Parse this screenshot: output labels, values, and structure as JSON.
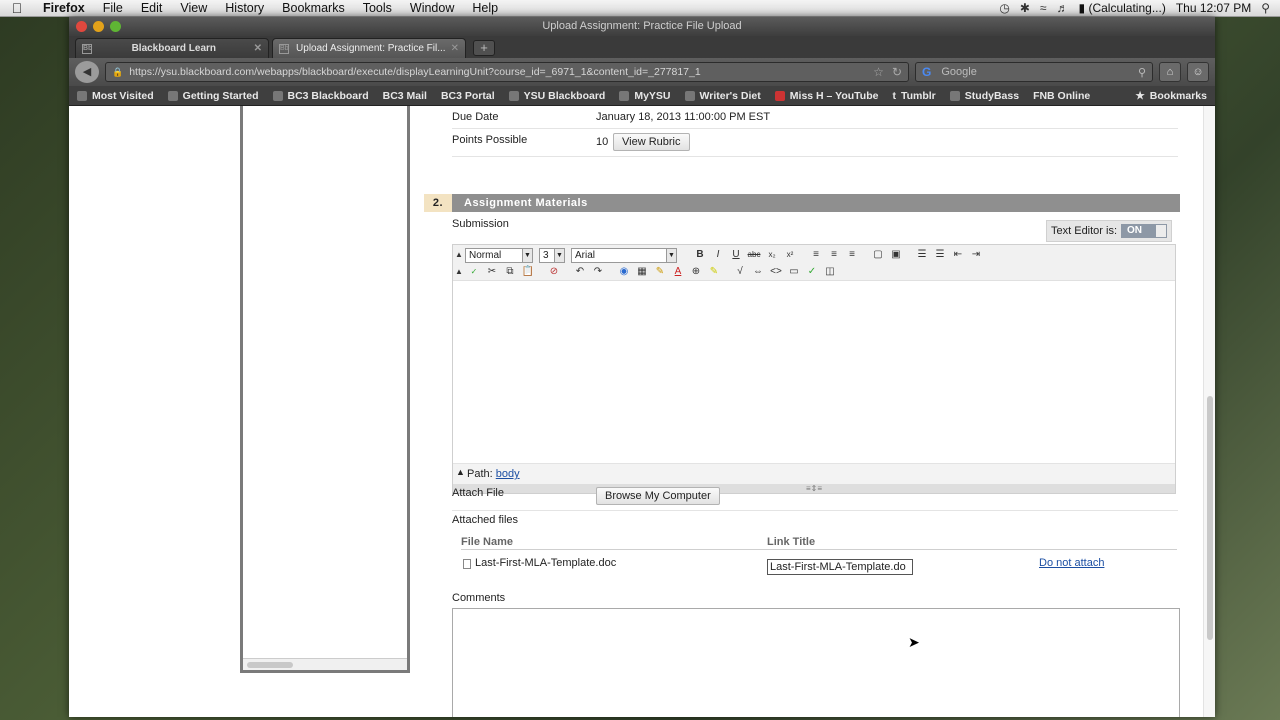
{
  "menubar": {
    "app": "Firefox",
    "items": [
      "File",
      "Edit",
      "View",
      "History",
      "Bookmarks",
      "Tools",
      "Window",
      "Help"
    ],
    "battery": "(Calculating...)",
    "clock": "Thu 12:07 PM"
  },
  "window": {
    "title": "Upload Assignment: Practice File Upload"
  },
  "tabs": [
    {
      "label": "Blackboard Learn"
    },
    {
      "label": "Upload Assignment: Practice Fil..."
    }
  ],
  "nav": {
    "url": "https://ysu.blackboard.com/webapps/blackboard/execute/displayLearningUnit?course_id=_6971_1&content_id=_277817_1",
    "search_engine": "Google",
    "search_placeholder": "Google"
  },
  "bookmarks": [
    "Most Visited",
    "Getting Started",
    "BC3 Blackboard",
    "BC3 Mail",
    "BC3 Portal",
    "YSU Blackboard",
    "MyYSU",
    "Writer's Diet",
    "Miss H – YouTube",
    "Tumblr",
    "StudyBass",
    "FNB Online"
  ],
  "bookmarks_menu": "Bookmarks",
  "assignment": {
    "due_date_label": "Due Date",
    "due_date_value": "January 18, 2013 11:00:00 PM EST",
    "points_label": "Points Possible",
    "points_value": "10",
    "view_rubric": "View Rubric"
  },
  "section": {
    "number": "2.",
    "title": "Assignment Materials"
  },
  "submission": {
    "label": "Submission",
    "text_editor_label": "Text Editor is:",
    "text_editor_state": "ON",
    "format_select": "Normal",
    "size_select": "3",
    "font_select": "Arial",
    "path_label": "Path:",
    "path_value": "body"
  },
  "attach": {
    "attach_label": "Attach File",
    "browse_button": "Browse My Computer",
    "attached_label": "Attached files",
    "col_file_name": "File Name",
    "col_link_title": "Link Title",
    "file_name": "Last-First-MLA-Template.doc",
    "link_title_value": "Last-First-MLA-Template.do",
    "do_not_attach": "Do not attach"
  },
  "comments": {
    "label": "Comments"
  }
}
